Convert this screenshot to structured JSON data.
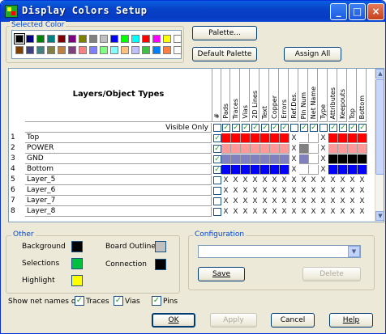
{
  "window": {
    "title": "Display Colors Setup",
    "minimize": "_",
    "maximize": "□",
    "close": "×"
  },
  "selected_color": {
    "label": "Selected Color",
    "row1": [
      "#000000",
      "#000080",
      "#008000",
      "#008080",
      "#800000",
      "#800080",
      "#808000",
      "#808080",
      "#c0c0c0",
      "#0000ff",
      "#00ff00",
      "#00ffff",
      "#ff0000",
      "#ff00ff",
      "#ffff00",
      "#ffffff"
    ],
    "row2": [
      "#804000",
      "#404080",
      "#408080",
      "#808040",
      "#c08040",
      "#804080",
      "#ff8080",
      "#8080ff",
      "#80ff80",
      "#80ffff",
      "#ffc080",
      "#c0c0ff",
      "#40c040",
      "#0080ff",
      "#ff8040",
      "#ffffff"
    ]
  },
  "buttons": {
    "palette": "Palette...",
    "default_palette": "Default Palette",
    "assign_all": "Assign All",
    "save": "Save",
    "delete": "Delete",
    "ok": "OK",
    "apply": "Apply",
    "cancel": "Cancel",
    "help": "Help"
  },
  "grid": {
    "header": "Layers/Object Types",
    "hash_header": "#",
    "visible_only": "Visible Only",
    "columns": [
      "Pads",
      "Traces",
      "Vias",
      "2D Lines",
      "Text",
      "Copper",
      "Errors",
      "Ref.Des.",
      "Pin Num",
      "Net Name",
      "Type",
      "Attributes",
      "Keepouts",
      "Top",
      "Bottom"
    ],
    "rows": [
      {
        "num": "1",
        "name": "Top",
        "checked": true,
        "cells": [
          "#ff0000",
          "#ff0000",
          "#ff0000",
          "#ff0000",
          "#ff0000",
          "#ff0000",
          "#ff0000",
          "X",
          "",
          "",
          "X",
          "#ff0000",
          "#ff0000",
          "#ff0000",
          "#ff0000"
        ]
      },
      {
        "num": "2",
        "name": "POWER",
        "checked": true,
        "cells": [
          "#ff9999",
          "#ff9999",
          "#ff9999",
          "#ff9999",
          "#ff9999",
          "#ff9999",
          "#ff9999",
          "X",
          "#808080",
          "",
          "X",
          "#ff9999",
          "#ff9999",
          "#ff9999",
          "#ff9999"
        ]
      },
      {
        "num": "3",
        "name": "GND",
        "checked": true,
        "cells": [
          "#8080c0",
          "#8080c0",
          "#8080c0",
          "#8080c0",
          "#8080c0",
          "#8080c0",
          "#8080c0",
          "X",
          "#8080c0",
          "",
          "X",
          "#000000",
          "#000000",
          "#000000",
          "#000000"
        ]
      },
      {
        "num": "4",
        "name": "Bottom",
        "checked": true,
        "cells": [
          "#0000ff",
          "#0000ff",
          "#0000ff",
          "#0000ff",
          "#0000ff",
          "#0000ff",
          "#0000ff",
          "X",
          "",
          "",
          "X",
          "#0000ff",
          "#0000ff",
          "#0000ff",
          "#0000ff"
        ]
      },
      {
        "num": "5",
        "name": "Layer_5",
        "checked": false,
        "cells": [
          "X",
          "X",
          "X",
          "X",
          "X",
          "X",
          "X",
          "X",
          "X",
          "X",
          "X",
          "X",
          "X",
          "X",
          "X"
        ]
      },
      {
        "num": "6",
        "name": "Layer_6",
        "checked": false,
        "cells": [
          "X",
          "X",
          "X",
          "X",
          "X",
          "X",
          "X",
          "X",
          "X",
          "X",
          "X",
          "X",
          "X",
          "X",
          "X"
        ]
      },
      {
        "num": "7",
        "name": "Layer_7",
        "checked": false,
        "cells": [
          "X",
          "X",
          "X",
          "X",
          "X",
          "X",
          "X",
          "X",
          "X",
          "X",
          "X",
          "X",
          "X",
          "X",
          "X"
        ]
      },
      {
        "num": "8",
        "name": "Layer_8",
        "checked": false,
        "cells": [
          "X",
          "X",
          "X",
          "X",
          "X",
          "X",
          "X",
          "X",
          "X",
          "X",
          "X",
          "X",
          "X",
          "X",
          "X"
        ]
      }
    ],
    "visible_only_checks": [
      false,
      true,
      true,
      true,
      true,
      true,
      true,
      true,
      false,
      true,
      true,
      false,
      true,
      true,
      true,
      true
    ]
  },
  "other": {
    "label": "Other",
    "background": {
      "label": "Background",
      "color": "#000000"
    },
    "selections": {
      "label": "Selections",
      "color": "#00c040"
    },
    "highlight": {
      "label": "Highlight",
      "color": "#ffff00"
    },
    "board_outline": {
      "label": "Board Outline",
      "color": "#c0c0c0"
    },
    "connection": {
      "label": "Connection",
      "color": "#000000"
    }
  },
  "configuration": {
    "label": "Configuration",
    "value": ""
  },
  "net_names": {
    "label": "Show net names on",
    "traces": {
      "label": "Traces",
      "checked": true
    },
    "vias": {
      "label": "Vias",
      "checked": true
    },
    "pins": {
      "label": "Pins",
      "checked": true
    }
  }
}
